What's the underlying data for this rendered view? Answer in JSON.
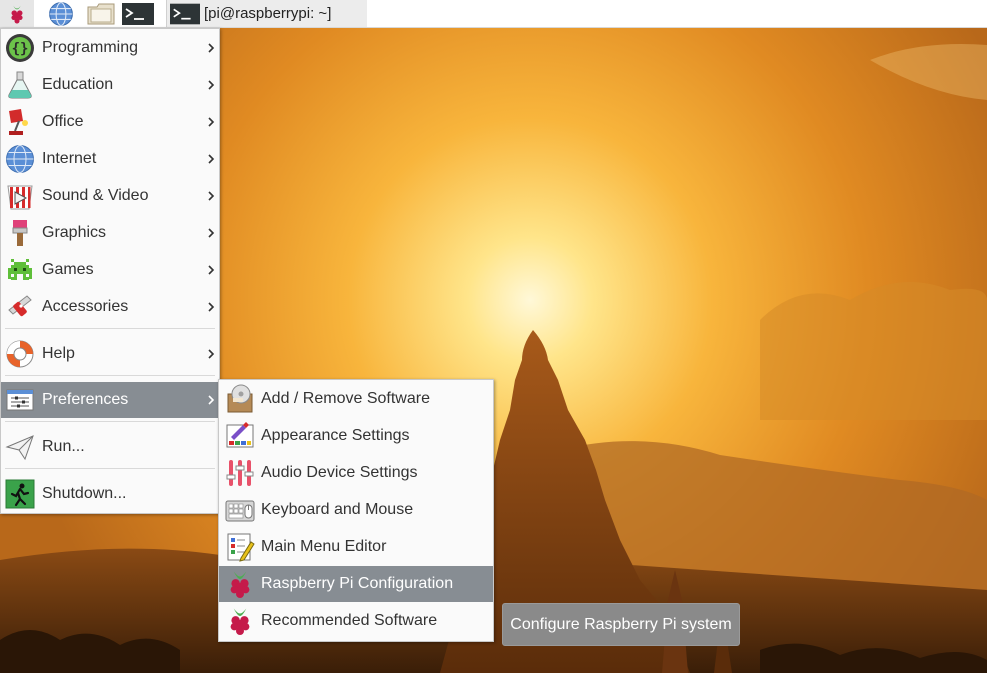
{
  "taskbar": {
    "window_title": "[pi@raspberrypi: ~]",
    "launchers": [
      {
        "name": "raspberry-menu",
        "icon": "raspberry-icon"
      },
      {
        "name": "web-browser",
        "icon": "globe-icon"
      },
      {
        "name": "file-manager",
        "icon": "folder-icon"
      },
      {
        "name": "terminal",
        "icon": "terminal-icon"
      }
    ]
  },
  "main_menu": {
    "items": [
      {
        "label": "Programming",
        "icon": "programming-icon",
        "has_submenu": true
      },
      {
        "label": "Education",
        "icon": "education-icon",
        "has_submenu": true
      },
      {
        "label": "Office",
        "icon": "office-icon",
        "has_submenu": true
      },
      {
        "label": "Internet",
        "icon": "internet-icon",
        "has_submenu": true
      },
      {
        "label": "Sound & Video",
        "icon": "sound-video-icon",
        "has_submenu": true
      },
      {
        "label": "Graphics",
        "icon": "graphics-icon",
        "has_submenu": true
      },
      {
        "label": "Games",
        "icon": "games-icon",
        "has_submenu": true
      },
      {
        "label": "Accessories",
        "icon": "accessories-icon",
        "has_submenu": true
      },
      {
        "label": "Help",
        "icon": "help-icon",
        "has_submenu": true
      },
      {
        "label": "Preferences",
        "icon": "preferences-icon",
        "has_submenu": true,
        "active": true
      },
      {
        "label": "Run...",
        "icon": "run-icon",
        "has_submenu": false
      },
      {
        "label": "Shutdown...",
        "icon": "shutdown-icon",
        "has_submenu": false
      }
    ]
  },
  "preferences_menu": {
    "items": [
      {
        "label": "Add / Remove Software",
        "icon": "package-icon"
      },
      {
        "label": "Appearance Settings",
        "icon": "appearance-icon"
      },
      {
        "label": "Audio Device Settings",
        "icon": "audio-sliders-icon"
      },
      {
        "label": "Keyboard and Mouse",
        "icon": "keyboard-mouse-icon"
      },
      {
        "label": "Main Menu Editor",
        "icon": "menu-editor-icon"
      },
      {
        "label": "Raspberry Pi Configuration",
        "icon": "raspberry-icon",
        "active": true
      },
      {
        "label": "Recommended Software",
        "icon": "raspberry-icon"
      }
    ]
  },
  "tooltip": {
    "text": "Configure Raspberry Pi system"
  },
  "colors": {
    "menu_highlight": "#878d93",
    "menu_bg": "#fafafa",
    "tooltip_bg": "#8a8a8a"
  }
}
